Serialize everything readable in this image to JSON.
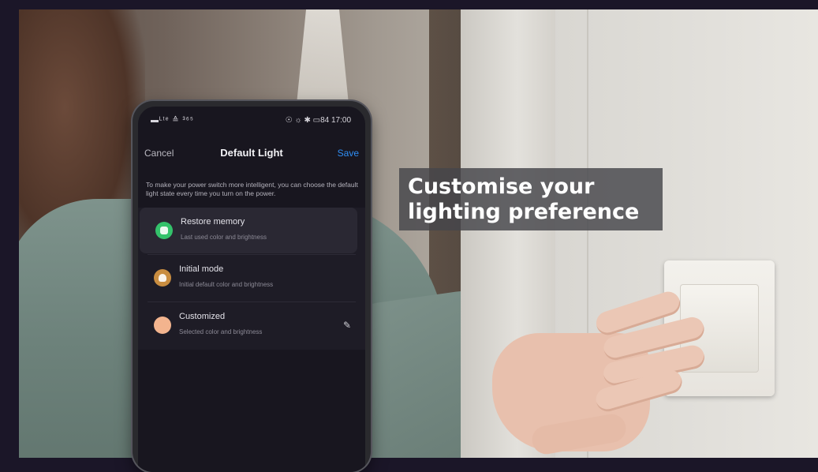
{
  "caption": {
    "line1": "Customise your",
    "line2": "lighting preference"
  },
  "phone": {
    "status_left": "▬ᴸᵗᵉ ≙ ³⁶⁵",
    "status_right": "☉ ☼ ✱ ▭84 17:00",
    "nav": {
      "cancel": "Cancel",
      "title": "Default Light",
      "save": "Save"
    },
    "description": "To make your power switch more intelligent, you can choose the default light state every time you turn on the power.",
    "options": [
      {
        "name": "Restore memory",
        "subtitle": "Last used color and brightness",
        "icon": "memory-icon",
        "color": "#34c26b",
        "selected": true
      },
      {
        "name": "Initial mode",
        "subtitle": "Initial default color and brightness",
        "icon": "bulb-icon",
        "color": "#c98d40",
        "selected": false
      },
      {
        "name": "Customized",
        "subtitle": "Selected color and brightness",
        "icon": "color-swatch-icon",
        "color": "#f3b48e",
        "selected": false,
        "action_icon": "edit-icon"
      }
    ]
  },
  "colors": {
    "accent": "#2f8ef4",
    "page_border": "#1b1628"
  }
}
